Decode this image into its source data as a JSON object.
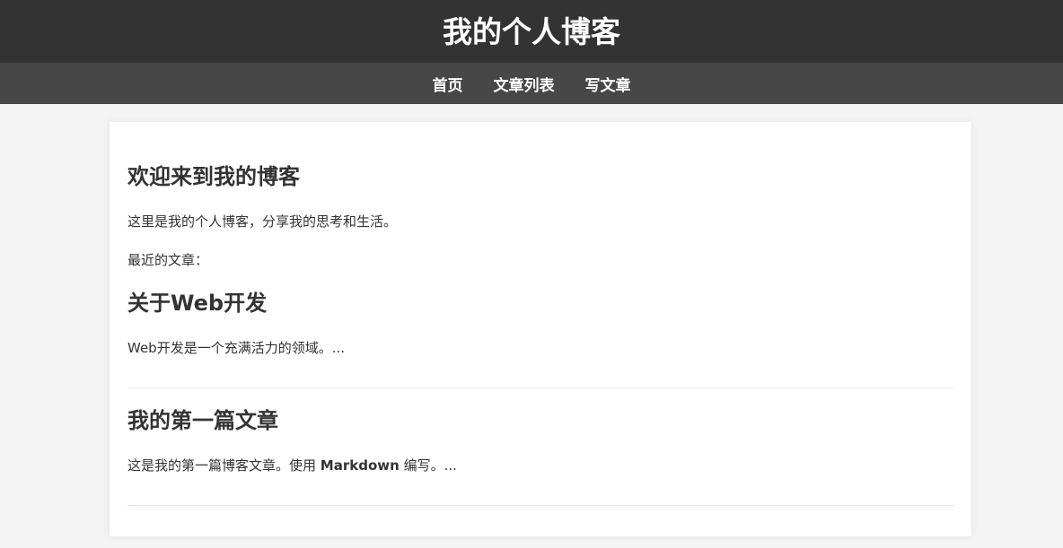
{
  "header": {
    "title": "我的个人博客"
  },
  "nav": {
    "items": [
      {
        "label": "首页"
      },
      {
        "label": "文章列表"
      },
      {
        "label": "写文章"
      }
    ]
  },
  "main": {
    "welcome_title": "欢迎来到我的博客",
    "intro": "这里是我的个人博客，分享我的思考和生活。",
    "recent_label": "最近的文章：",
    "posts": [
      {
        "title": "关于Web开发",
        "excerpt": "Web开发是一个充满活力的领域。..."
      },
      {
        "title": "我的第一篇文章",
        "excerpt_before": "这是我的第一篇博客文章。使用 ",
        "excerpt_bold": "Markdown",
        "excerpt_after": " 编写。..."
      }
    ]
  },
  "colors": {
    "header_bg": "#333333",
    "nav_bg": "#474747",
    "page_bg": "#f4f4f4",
    "card_bg": "#ffffff",
    "text": "#333333"
  }
}
